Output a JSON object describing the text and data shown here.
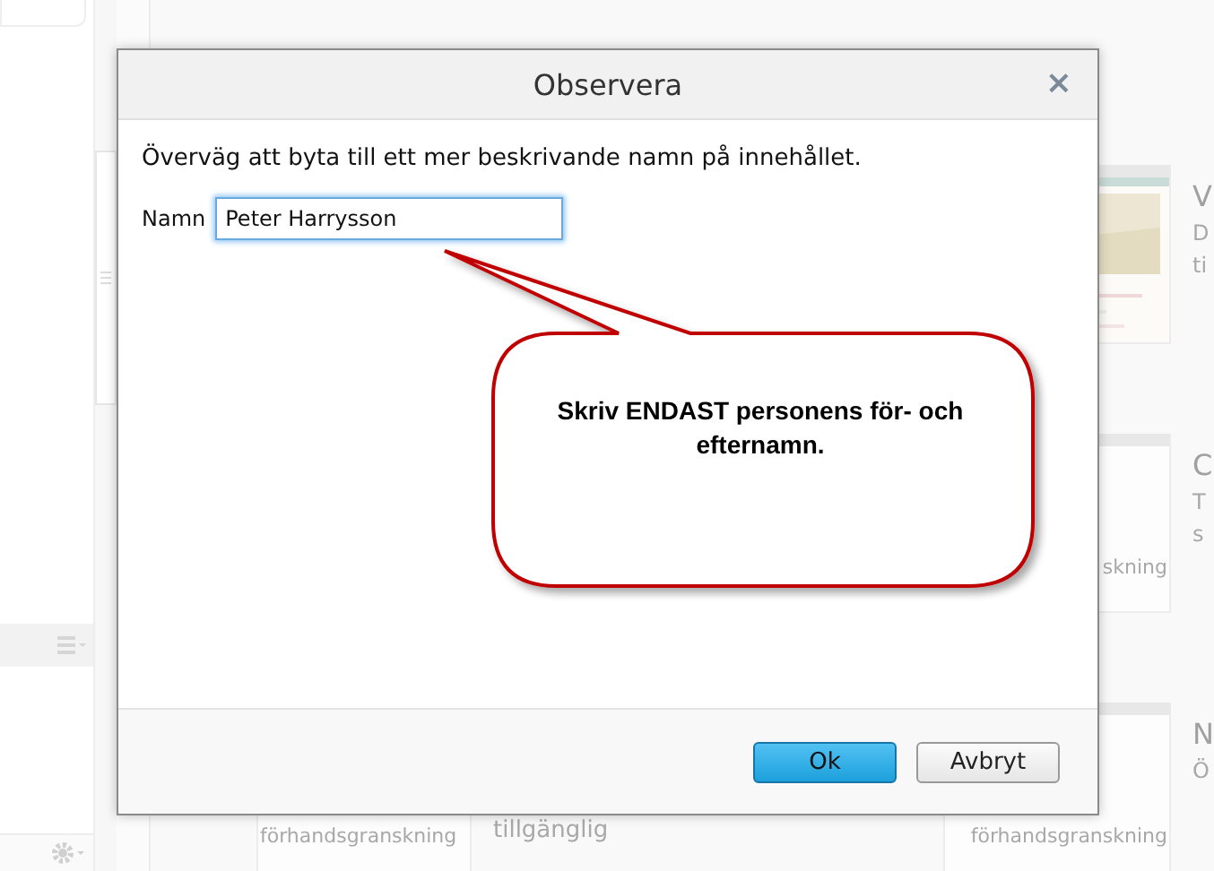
{
  "rows": [
    {
      "right": {
        "preview": {
          "kind": "picture"
        },
        "title": "V",
        "description": [
          "D",
          "ti"
        ]
      }
    },
    {
      "right": {
        "preview": {
          "kind": "text",
          "text": "skning"
        },
        "title": "C",
        "description": [
          "T",
          "s"
        ]
      }
    },
    {
      "left": {
        "preview": {
          "kind": "text",
          "text": "förhandsgranskning"
        },
        "status": "tillgänglig"
      },
      "right": {
        "preview": {
          "kind": "text",
          "text": "förhandsgranskning"
        },
        "title": "N",
        "description": [
          "Ö"
        ]
      }
    }
  ],
  "dialog": {
    "title": "Observera",
    "close": "×",
    "message": "Överväg att byta till ett mer beskrivande namn på innehållet.",
    "field": {
      "label": "Namn",
      "value": "Peter Harrysson",
      "focused": true
    },
    "buttons": [
      {
        "label": "Ok",
        "primary": true
      },
      {
        "label": "Avbryt",
        "primary": false
      }
    ]
  },
  "callout": {
    "text": "Skriv ENDAST personens för- och efternamn."
  }
}
